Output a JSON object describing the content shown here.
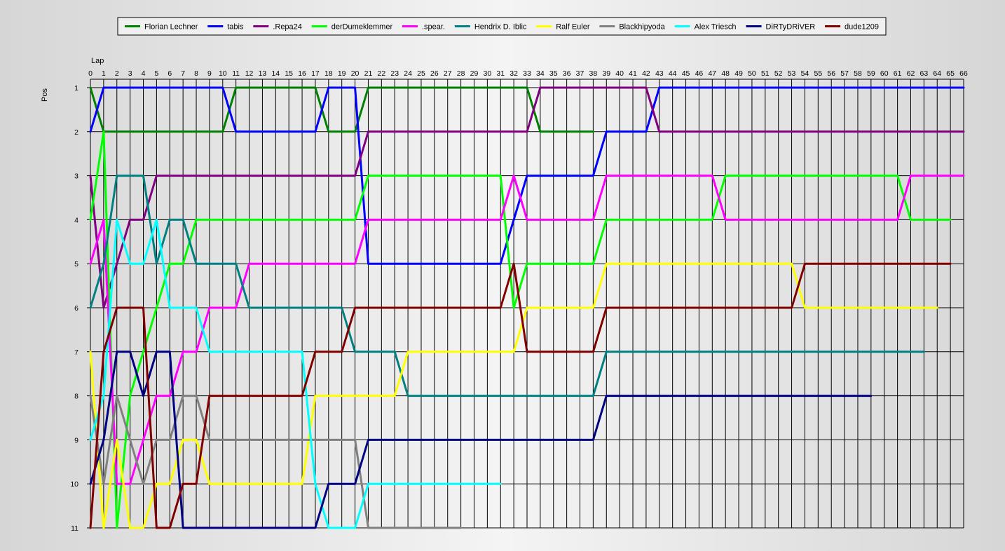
{
  "chart_data": {
    "type": "line",
    "xlabel": "Lap",
    "ylabel": "Pos",
    "xlim": [
      0,
      66
    ],
    "ylim": [
      1,
      11
    ],
    "y_inverted": true,
    "grid": true,
    "legend_position": "top",
    "x_ticks": [
      0,
      1,
      2,
      3,
      4,
      5,
      6,
      7,
      8,
      9,
      10,
      11,
      12,
      13,
      14,
      15,
      16,
      17,
      18,
      19,
      20,
      21,
      22,
      23,
      24,
      25,
      26,
      27,
      28,
      29,
      30,
      31,
      32,
      33,
      34,
      35,
      36,
      37,
      38,
      39,
      40,
      41,
      42,
      43,
      44,
      45,
      46,
      47,
      48,
      49,
      50,
      51,
      52,
      53,
      54,
      55,
      56,
      57,
      58,
      59,
      60,
      61,
      62,
      63,
      64,
      65,
      66
    ],
    "y_ticks": [
      1,
      2,
      3,
      4,
      5,
      6,
      7,
      8,
      9,
      10,
      11
    ],
    "series": [
      {
        "name": "Florian Lechner",
        "color": "#008000",
        "points": [
          [
            0,
            1
          ],
          [
            1,
            2
          ],
          [
            2,
            2
          ],
          [
            10,
            2
          ],
          [
            11,
            1
          ],
          [
            17,
            1
          ],
          [
            18,
            2
          ],
          [
            20,
            2
          ],
          [
            21,
            1
          ],
          [
            33,
            1
          ],
          [
            34,
            2
          ],
          [
            38,
            2
          ]
        ]
      },
      {
        "name": "tabis",
        "color": "#0000ff",
        "points": [
          [
            0,
            2
          ],
          [
            1,
            1
          ],
          [
            10,
            1
          ],
          [
            11,
            2
          ],
          [
            17,
            2
          ],
          [
            18,
            1
          ],
          [
            20,
            1
          ],
          [
            21,
            5
          ],
          [
            31,
            5
          ],
          [
            32,
            4
          ],
          [
            33,
            3
          ],
          [
            38,
            3
          ],
          [
            39,
            2
          ],
          [
            42,
            2
          ],
          [
            43,
            1
          ],
          [
            66,
            1
          ]
        ]
      },
      {
        "name": ".Repa24",
        "color": "#800080",
        "points": [
          [
            0,
            3
          ],
          [
            1,
            6
          ],
          [
            2,
            5
          ],
          [
            3,
            4
          ],
          [
            4,
            4
          ],
          [
            5,
            3
          ],
          [
            20,
            3
          ],
          [
            21,
            2
          ],
          [
            33,
            2
          ],
          [
            34,
            1
          ],
          [
            42,
            1
          ],
          [
            43,
            2
          ],
          [
            66,
            2
          ]
        ]
      },
      {
        "name": "derDumeklemmer",
        "color": "#00ff00",
        "points": [
          [
            0,
            4
          ],
          [
            1,
            2
          ],
          [
            2,
            11
          ],
          [
            3,
            8
          ],
          [
            4,
            7
          ],
          [
            5,
            6
          ],
          [
            6,
            5
          ],
          [
            7,
            5
          ],
          [
            8,
            4
          ],
          [
            20,
            4
          ],
          [
            21,
            3
          ],
          [
            31,
            3
          ],
          [
            32,
            6
          ],
          [
            33,
            5
          ],
          [
            38,
            5
          ],
          [
            39,
            4
          ],
          [
            47,
            4
          ],
          [
            48,
            3
          ],
          [
            61,
            3
          ],
          [
            62,
            4
          ],
          [
            65,
            4
          ]
        ]
      },
      {
        "name": ".spear.",
        "color": "#ff00ff",
        "points": [
          [
            0,
            5
          ],
          [
            1,
            4
          ],
          [
            2,
            10
          ],
          [
            3,
            10
          ],
          [
            4,
            9
          ],
          [
            5,
            8
          ],
          [
            6,
            8
          ],
          [
            7,
            7
          ],
          [
            8,
            7
          ],
          [
            9,
            6
          ],
          [
            11,
            6
          ],
          [
            12,
            5
          ],
          [
            20,
            5
          ],
          [
            21,
            4
          ],
          [
            31,
            4
          ],
          [
            32,
            3
          ],
          [
            33,
            4
          ],
          [
            38,
            4
          ],
          [
            39,
            3
          ],
          [
            47,
            3
          ],
          [
            48,
            4
          ],
          [
            61,
            4
          ],
          [
            62,
            3
          ],
          [
            66,
            3
          ]
        ]
      },
      {
        "name": "Hendrix D. Iblic",
        "color": "#008080",
        "points": [
          [
            0,
            6
          ],
          [
            1,
            5
          ],
          [
            2,
            3
          ],
          [
            4,
            3
          ],
          [
            5,
            5
          ],
          [
            6,
            4
          ],
          [
            7,
            4
          ],
          [
            8,
            5
          ],
          [
            11,
            5
          ],
          [
            12,
            6
          ],
          [
            19,
            6
          ],
          [
            20,
            7
          ],
          [
            23,
            7
          ],
          [
            24,
            8
          ],
          [
            38,
            8
          ],
          [
            39,
            7
          ],
          [
            63,
            7
          ]
        ]
      },
      {
        "name": "Ralf Euler",
        "color": "#ffff00",
        "points": [
          [
            0,
            7
          ],
          [
            1,
            11
          ],
          [
            2,
            9
          ],
          [
            3,
            11
          ],
          [
            4,
            11
          ],
          [
            5,
            10
          ],
          [
            6,
            10
          ],
          [
            7,
            9
          ],
          [
            8,
            9
          ],
          [
            9,
            10
          ],
          [
            16,
            10
          ],
          [
            17,
            8
          ],
          [
            23,
            8
          ],
          [
            24,
            7
          ],
          [
            32,
            7
          ],
          [
            33,
            6
          ],
          [
            38,
            6
          ],
          [
            39,
            5
          ],
          [
            53,
            5
          ],
          [
            54,
            6
          ],
          [
            64,
            6
          ]
        ]
      },
      {
        "name": "Blackhipyoda",
        "color": "#808080",
        "points": [
          [
            0,
            8
          ],
          [
            1,
            10
          ],
          [
            2,
            8
          ],
          [
            3,
            9
          ],
          [
            4,
            10
          ],
          [
            5,
            9
          ],
          [
            6,
            9
          ],
          [
            7,
            8
          ],
          [
            8,
            8
          ],
          [
            9,
            9
          ],
          [
            20,
            9
          ],
          [
            21,
            11
          ],
          [
            28,
            11
          ]
        ]
      },
      {
        "name": "Alex Triesch",
        "color": "#00ffff",
        "points": [
          [
            0,
            9
          ],
          [
            1,
            8
          ],
          [
            2,
            4
          ],
          [
            3,
            5
          ],
          [
            4,
            5
          ],
          [
            5,
            4
          ],
          [
            6,
            6
          ],
          [
            8,
            6
          ],
          [
            9,
            7
          ],
          [
            16,
            7
          ],
          [
            17,
            10
          ],
          [
            18,
            11
          ],
          [
            20,
            11
          ],
          [
            21,
            10
          ],
          [
            31,
            10
          ]
        ]
      },
      {
        "name": "DiRTyDRiVER",
        "color": "#000080",
        "points": [
          [
            0,
            10
          ],
          [
            1,
            9
          ],
          [
            2,
            7
          ],
          [
            3,
            7
          ],
          [
            4,
            8
          ],
          [
            5,
            7
          ],
          [
            6,
            7
          ],
          [
            7,
            11
          ],
          [
            17,
            11
          ],
          [
            18,
            10
          ],
          [
            20,
            10
          ],
          [
            21,
            9
          ],
          [
            38,
            9
          ],
          [
            39,
            8
          ],
          [
            59,
            8
          ]
        ]
      },
      {
        "name": "dude1209",
        "color": "#800000",
        "points": [
          [
            0,
            11
          ],
          [
            1,
            7
          ],
          [
            2,
            6
          ],
          [
            4,
            6
          ],
          [
            5,
            11
          ],
          [
            6,
            11
          ],
          [
            7,
            10
          ],
          [
            8,
            10
          ],
          [
            9,
            8
          ],
          [
            16,
            8
          ],
          [
            17,
            7
          ],
          [
            19,
            7
          ],
          [
            20,
            6
          ],
          [
            31,
            6
          ],
          [
            32,
            5
          ],
          [
            33,
            7
          ],
          [
            38,
            7
          ],
          [
            39,
            6
          ],
          [
            53,
            6
          ],
          [
            54,
            5
          ],
          [
            65,
            5
          ]
        ]
      }
    ]
  }
}
